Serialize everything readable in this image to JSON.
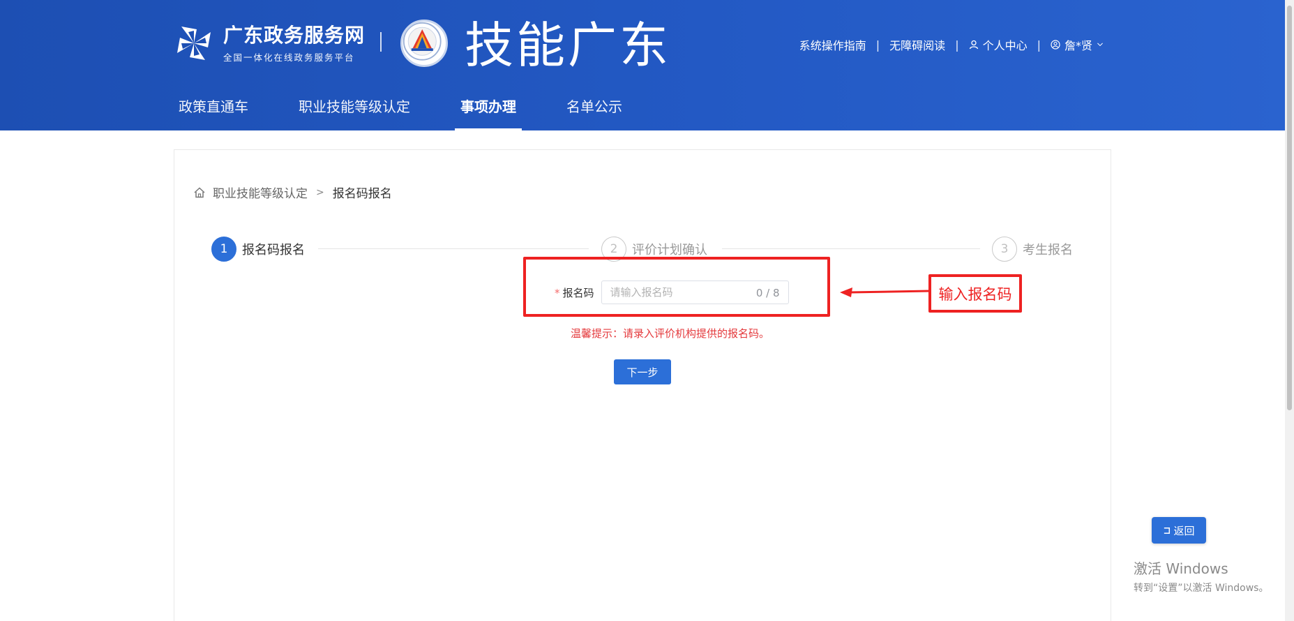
{
  "header": {
    "portal_title": "广东政务服务网",
    "portal_subtitle": "全国一体化在线政务服务平台",
    "site_title": "技能广东",
    "links": {
      "guide": "系统操作指南",
      "accessible": "无障碍阅读",
      "personal_center": "个人中心",
      "user": "詹*贤"
    },
    "separator": "|"
  },
  "nav": {
    "tabs": [
      {
        "label": "政策直通车",
        "active": false
      },
      {
        "label": "职业技能等级认定",
        "active": false
      },
      {
        "label": "事项办理",
        "active": true
      },
      {
        "label": "名单公示",
        "active": false
      }
    ]
  },
  "breadcrumb": {
    "parent": "职业技能等级认定",
    "separator": ">",
    "current": "报名码报名"
  },
  "steps": [
    {
      "num": "1",
      "label": "报名码报名",
      "active": true
    },
    {
      "num": "2",
      "label": "评价计划确认",
      "active": false
    },
    {
      "num": "3",
      "label": "考生报名",
      "active": false
    }
  ],
  "form": {
    "required_mark": "*",
    "label": "报名码",
    "value": "",
    "placeholder": "请输入报名码",
    "counter": "0 / 8",
    "tip": "温馨提示：请录入评价机构提供的报名码。",
    "next_label": "下一步"
  },
  "annotation": {
    "label": "输入报名码",
    "color": "#ee2222"
  },
  "return_button": {
    "label": "返回",
    "icon": "return-icon"
  },
  "watermark": {
    "line1": "激活 Windows",
    "line2": "转到“设置”以激活 Windows。"
  },
  "colors": {
    "primary": "#2c6fd8",
    "header": "#2359c4",
    "warning": "#e4393c"
  }
}
